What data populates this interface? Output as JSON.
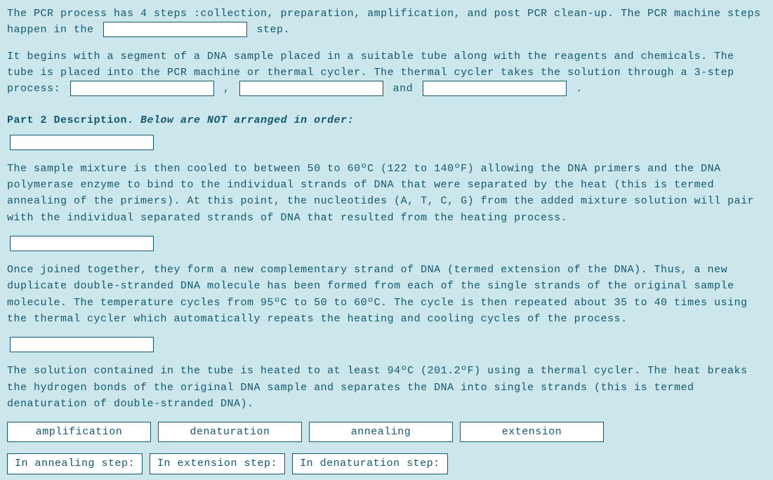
{
  "intro": {
    "p1a": "The PCR process has 4 steps :collection, preparation, amplification, and post PCR clean-up. The PCR machine steps happen in the ",
    "p1b": " step.",
    "p2a": "It begins with a segment of a DNA sample placed in a suitable tube along with the reagents and chemicals. The tube is placed into the PCR machine or thermal cycler. The thermal cycler takes the solution through a 3-step process: ",
    "p2b": " , ",
    "p2c": " and ",
    "p2d": " ."
  },
  "part2": {
    "heading_bold": "Part 2 Description.",
    "heading_ital": "Below are NOT arranged in order:",
    "desc1": "The sample mixture is then cooled to between 50 to 60ºC (122 to 140ºF) allowing the DNA primers and the DNA polymerase enzyme to bind to the individual strands of DNA that were separated by the heat (this is termed annealing of the primers). At this point, the nucleotides (A, T, C, G) from the added mixture solution will pair with the individual separated strands of DNA that resulted from the heating process.",
    "desc2": "Once joined together, they form a new complementary strand of DNA (termed extension of the DNA). Thus, a new duplicate double-stranded DNA molecule has been formed from each of the single strands of the original sample molecule. The temperature cycles from 95ºC to 50 to 60ºC. The cycle is then repeated about 35 to 40 times using the thermal cycler which automatically repeats the heating and cooling cycles of the process.",
    "desc3": "The solution contained in the tube is heated to at least 94ºC (201.2ºF) using a thermal cycler. The heat breaks the hydrogen bonds of the original DNA sample and separates the DNA into single strands (this is termed denaturation of double-stranded DNA)."
  },
  "wordbank": {
    "row1": [
      "amplification",
      "denaturation",
      "annealing",
      "extension"
    ],
    "row2": [
      "In annealing step:",
      "In extension step:",
      "In denaturation step:"
    ]
  }
}
